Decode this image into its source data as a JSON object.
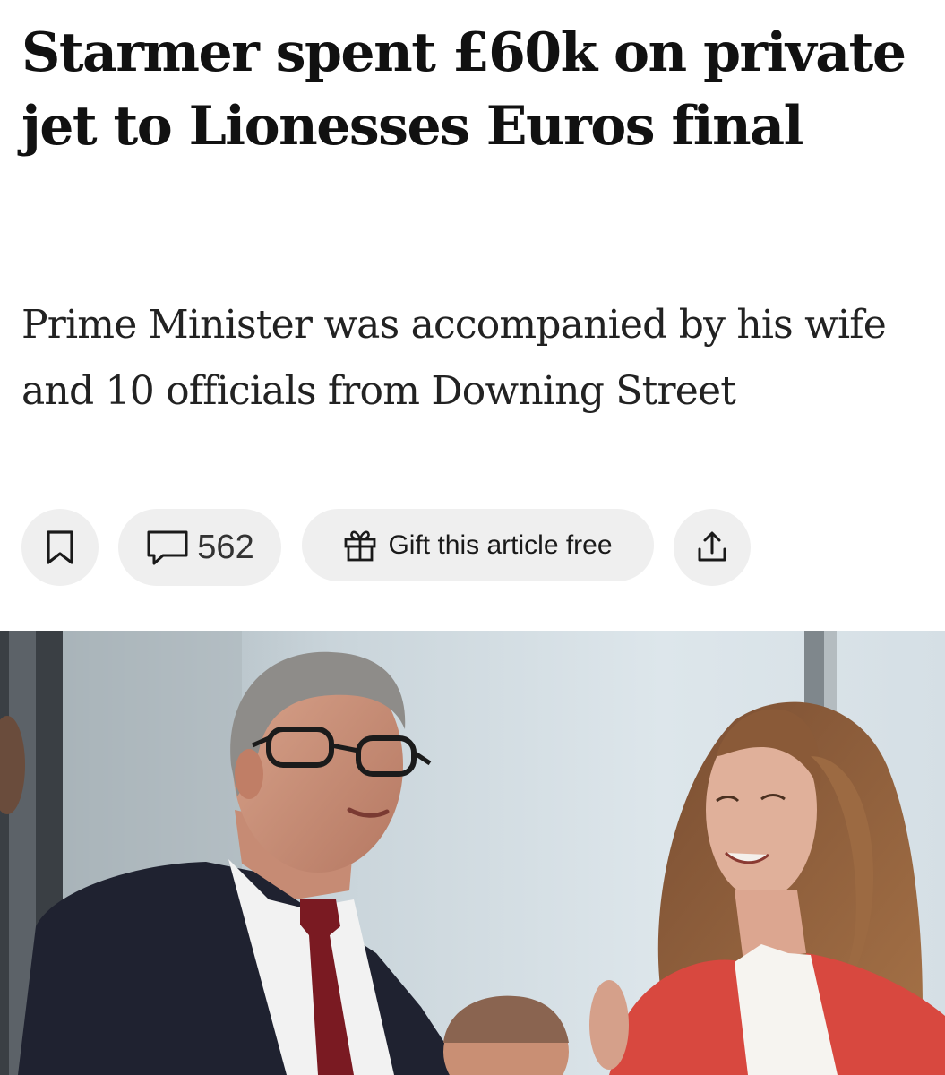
{
  "article": {
    "headline": "Starmer spent £60k on private jet to Lionesses Euros final",
    "standfirst": "Prime Minister was accompanied by his wife and 10 officials from Downing Street"
  },
  "actions": {
    "bookmark_icon": "bookmark-icon",
    "comment_icon": "speech-bubble-icon",
    "comment_count": "562",
    "gift_icon": "gift-icon",
    "gift_label": "Gift this article free",
    "share_icon": "share-icon"
  },
  "image": {
    "description_icon": "photo"
  }
}
